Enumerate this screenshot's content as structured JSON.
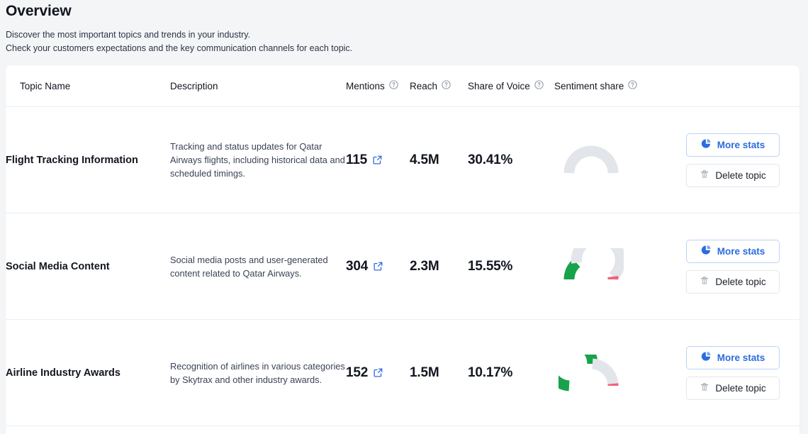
{
  "header": {
    "title": "Overview",
    "subtitle_line1": "Discover the most important topics and trends in your industry.",
    "subtitle_line2": "Check your customers expectations and the key communication channels for each topic."
  },
  "table": {
    "columns": [
      {
        "label": "Topic Name",
        "info": false
      },
      {
        "label": "Description",
        "info": false
      },
      {
        "label": "Mentions",
        "info": true
      },
      {
        "label": "Reach",
        "info": true
      },
      {
        "label": "Share of Voice",
        "info": true
      },
      {
        "label": "Sentiment share",
        "info": true
      }
    ],
    "rows": [
      {
        "topic": "Flight Tracking Information",
        "description": "Tracking and status updates for Qatar Airways flights, including historical data and scheduled timings.",
        "mentions": "115",
        "reach": "4.5M",
        "share_of_voice": "30.41%",
        "sentiment": {
          "positive_pct": 0,
          "negative_pct": 0,
          "neutral_pct": 100
        },
        "more_stats_label": "More stats",
        "delete_label": "Delete topic"
      },
      {
        "topic": "Social Media Content",
        "description": "Social media posts and user-generated content related to Qatar Airways.",
        "mentions": "304",
        "reach": "2.3M",
        "share_of_voice": "15.55%",
        "sentiment": {
          "positive_pct": 27,
          "negative_pct": 4,
          "neutral_pct": 69
        },
        "more_stats_label": "More stats",
        "delete_label": "Delete topic"
      },
      {
        "topic": "Airline Industry Awards",
        "description": "Recognition of airlines in various categories by Skytrax and other industry awards.",
        "mentions": "152",
        "reach": "1.5M",
        "share_of_voice": "10.17%",
        "sentiment": {
          "positive_pct": 52,
          "negative_pct": 3,
          "neutral_pct": 45
        },
        "more_stats_label": "More stats",
        "delete_label": "Delete topic"
      }
    ]
  },
  "icons": {
    "info": "info-question-icon",
    "external_link": "external-link-icon",
    "pie_chart": "pie-chart-icon",
    "trash": "trash-icon"
  },
  "colors": {
    "accent_blue": "#2b6cdf",
    "positive_green": "#16a34a",
    "negative_red": "#f2607a",
    "neutral_gray": "#e2e5ea",
    "page_bg": "#f4f5f7",
    "card_bg": "#ffffff"
  }
}
